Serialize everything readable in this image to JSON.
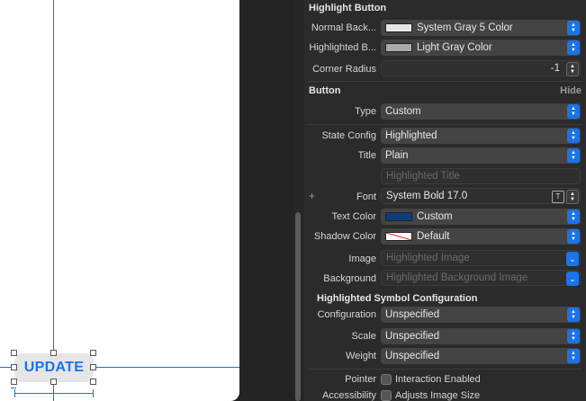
{
  "canvas": {
    "update_button": "UPDATE"
  },
  "highlight_button": {
    "header": "Highlight Button",
    "normal_background": {
      "label": "Normal Back...",
      "value": "System Gray 5 Color",
      "swatch": "#e5e5ea"
    },
    "highlighted_background": {
      "label": "Highlighted B...",
      "value": "Light Gray Color",
      "swatch": "#aaaaaa"
    },
    "corner_radius": {
      "label": "Corner Radius",
      "value": "-1"
    }
  },
  "button": {
    "header": "Button",
    "hide": "Hide",
    "type": {
      "label": "Type",
      "value": "Custom"
    },
    "state_config": {
      "label": "State Config",
      "value": "Highlighted"
    },
    "title": {
      "label": "Title",
      "value": "Plain"
    },
    "title_placeholder": "Highlighted Title",
    "font": {
      "label": "Font",
      "value": "System Bold 17.0",
      "plus": "+"
    },
    "text_color": {
      "label": "Text Color",
      "value": "Custom",
      "swatch": "#0d3e7a"
    },
    "shadow_color": {
      "label": "Shadow Color",
      "value": "Default"
    },
    "image": {
      "label": "Image",
      "placeholder": "Highlighted Image"
    },
    "background": {
      "label": "Background",
      "placeholder": "Highlighted Background Image"
    }
  },
  "symbol_config": {
    "header": "Highlighted Symbol Configuration",
    "configuration": {
      "label": "Configuration",
      "value": "Unspecified"
    },
    "scale": {
      "label": "Scale",
      "value": "Unspecified"
    },
    "weight": {
      "label": "Weight",
      "value": "Unspecified"
    }
  },
  "pointer": {
    "label": "Pointer",
    "option": "Interaction Enabled"
  },
  "accessibility": {
    "label": "Accessibility",
    "option": "Adjusts Image Size"
  },
  "colors": {
    "accent": "#1a73e8",
    "guide": "#2a6fb0"
  }
}
